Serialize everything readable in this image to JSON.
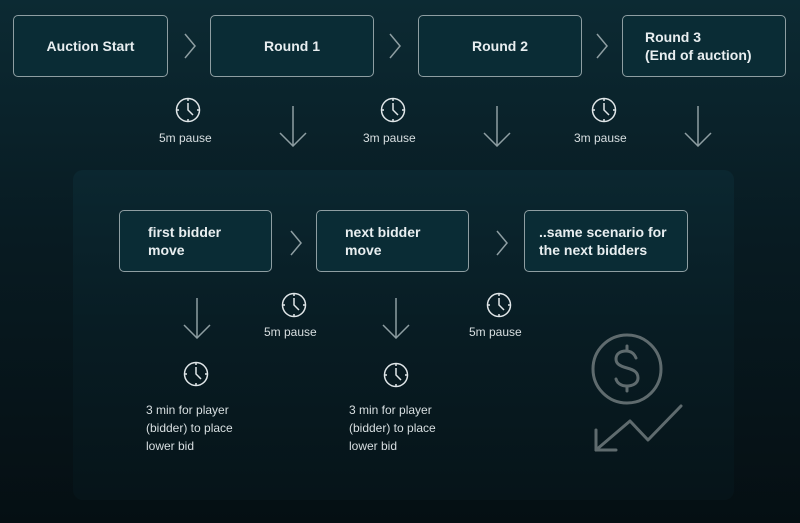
{
  "rounds": [
    {
      "label": "Auction Start"
    },
    {
      "label": "Round 1"
    },
    {
      "label": "Round 2"
    },
    {
      "label": "Round 3\n(End of auction)"
    }
  ],
  "round_pauses": [
    "5m pause",
    "3m pause",
    "3m pause"
  ],
  "bidder_steps": [
    {
      "label": "first bidder\nmove"
    },
    {
      "label": "next bidder\nmove"
    },
    {
      "label": "..same scenario for\nthe next bidders"
    }
  ],
  "bidder_pauses": [
    "5m pause",
    "5m pause"
  ],
  "bid_windows": [
    "3 min for player\n(bidder) to place\nlower bid",
    "3 min for player\n(bidder) to place\nlower bid"
  ],
  "icons": {
    "chevron": "chevron-right-icon",
    "arrow": "arrow-down-icon",
    "clock": "clock-icon",
    "decor": "dollar-price-down-icon"
  },
  "colors": {
    "box_border": "#8e9ea2",
    "box_fill": "#0a2c35",
    "text": "#e8eef0",
    "icon_muted": "#5f6b6e"
  }
}
